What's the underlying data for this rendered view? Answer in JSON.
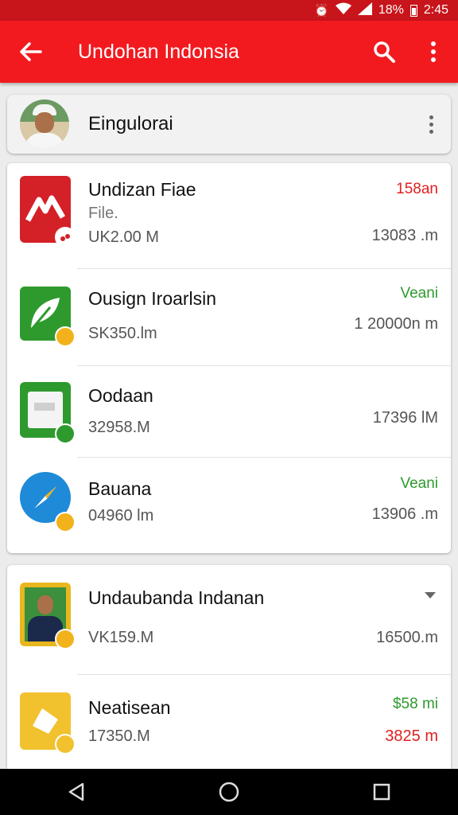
{
  "status_bar": {
    "battery": "18%",
    "time": "2:45"
  },
  "app_bar": {
    "title": "Undohan Indonsia"
  },
  "profile": {
    "name": "Eingulorai"
  },
  "card1": [
    {
      "name": "Undizan Fiae",
      "sub": "File.",
      "size": "UK2.00 M",
      "tag": "158an",
      "tag_color": "#e02020",
      "meta": "13083 .m"
    },
    {
      "name": "Ousign Iroarlsin",
      "size": "SK350.lm",
      "tag": "Veani",
      "tag_color": "#2e9a2e",
      "meta": "1 20000n m"
    },
    {
      "name": "Oodaan",
      "size": "32958.M",
      "meta": "17396 lM"
    },
    {
      "name": "Bauana",
      "size": "04960 lm",
      "tag": "Veani",
      "tag_color": "#2e9a2e",
      "meta": "13906 .m"
    }
  ],
  "card2": [
    {
      "name": "Undaubanda Indanan",
      "size": "VK159.M",
      "meta": "16500.m"
    },
    {
      "name": "Neatisean",
      "size": "17350.M",
      "tag": "$58 mi",
      "tag_color": "#2e9a2e",
      "meta": "3825 m",
      "meta_color": "#e02020"
    }
  ],
  "icons": {
    "card1": [
      "red-document-icon",
      "green-leaf-icon",
      "green-sheet-icon",
      "blue-compass-icon"
    ],
    "card2": [
      "portrait-icon",
      "yellow-folder-icon"
    ]
  },
  "colors": {
    "accent": "#f21a1f",
    "status_bar": "#c8141b",
    "green": "#2e9a2e",
    "red": "#e02020"
  }
}
